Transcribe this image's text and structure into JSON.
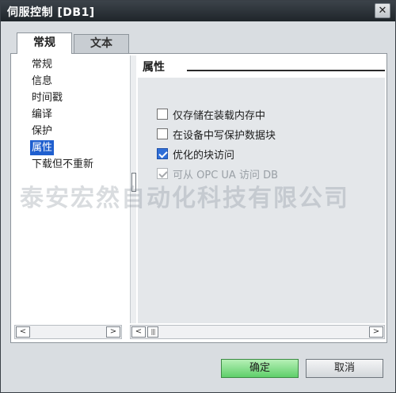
{
  "window": {
    "title": "伺服控制 [DB1]",
    "close_glyph": "✕"
  },
  "tabs": [
    {
      "label": "常规"
    },
    {
      "label": "文本"
    }
  ],
  "nav": {
    "items": [
      "常规",
      "信息",
      "时间戳",
      "编译",
      "保护",
      "属性",
      "下载但不重新"
    ],
    "selected": "属性"
  },
  "section": {
    "title": "属性"
  },
  "options": [
    {
      "label": "仅存储在装载内存中",
      "checked": false,
      "enabled": true
    },
    {
      "label": "在设备中写保护数据块",
      "checked": false,
      "enabled": true
    },
    {
      "label": "优化的块访问",
      "checked": true,
      "enabled": true
    },
    {
      "label": "可从 OPC UA 访问 DB",
      "checked": true,
      "enabled": false
    }
  ],
  "scroll": {
    "left_arrow": "<",
    "right_arrow": ">",
    "thumb": "|||"
  },
  "watermark": "泰安宏然自动化科技有限公司",
  "buttons": {
    "ok": "确定",
    "cancel": "取消"
  },
  "colors": {
    "selection": "#1f5fcf",
    "ok_button": "#5fcf6a",
    "titlebar": "#2b3137"
  }
}
